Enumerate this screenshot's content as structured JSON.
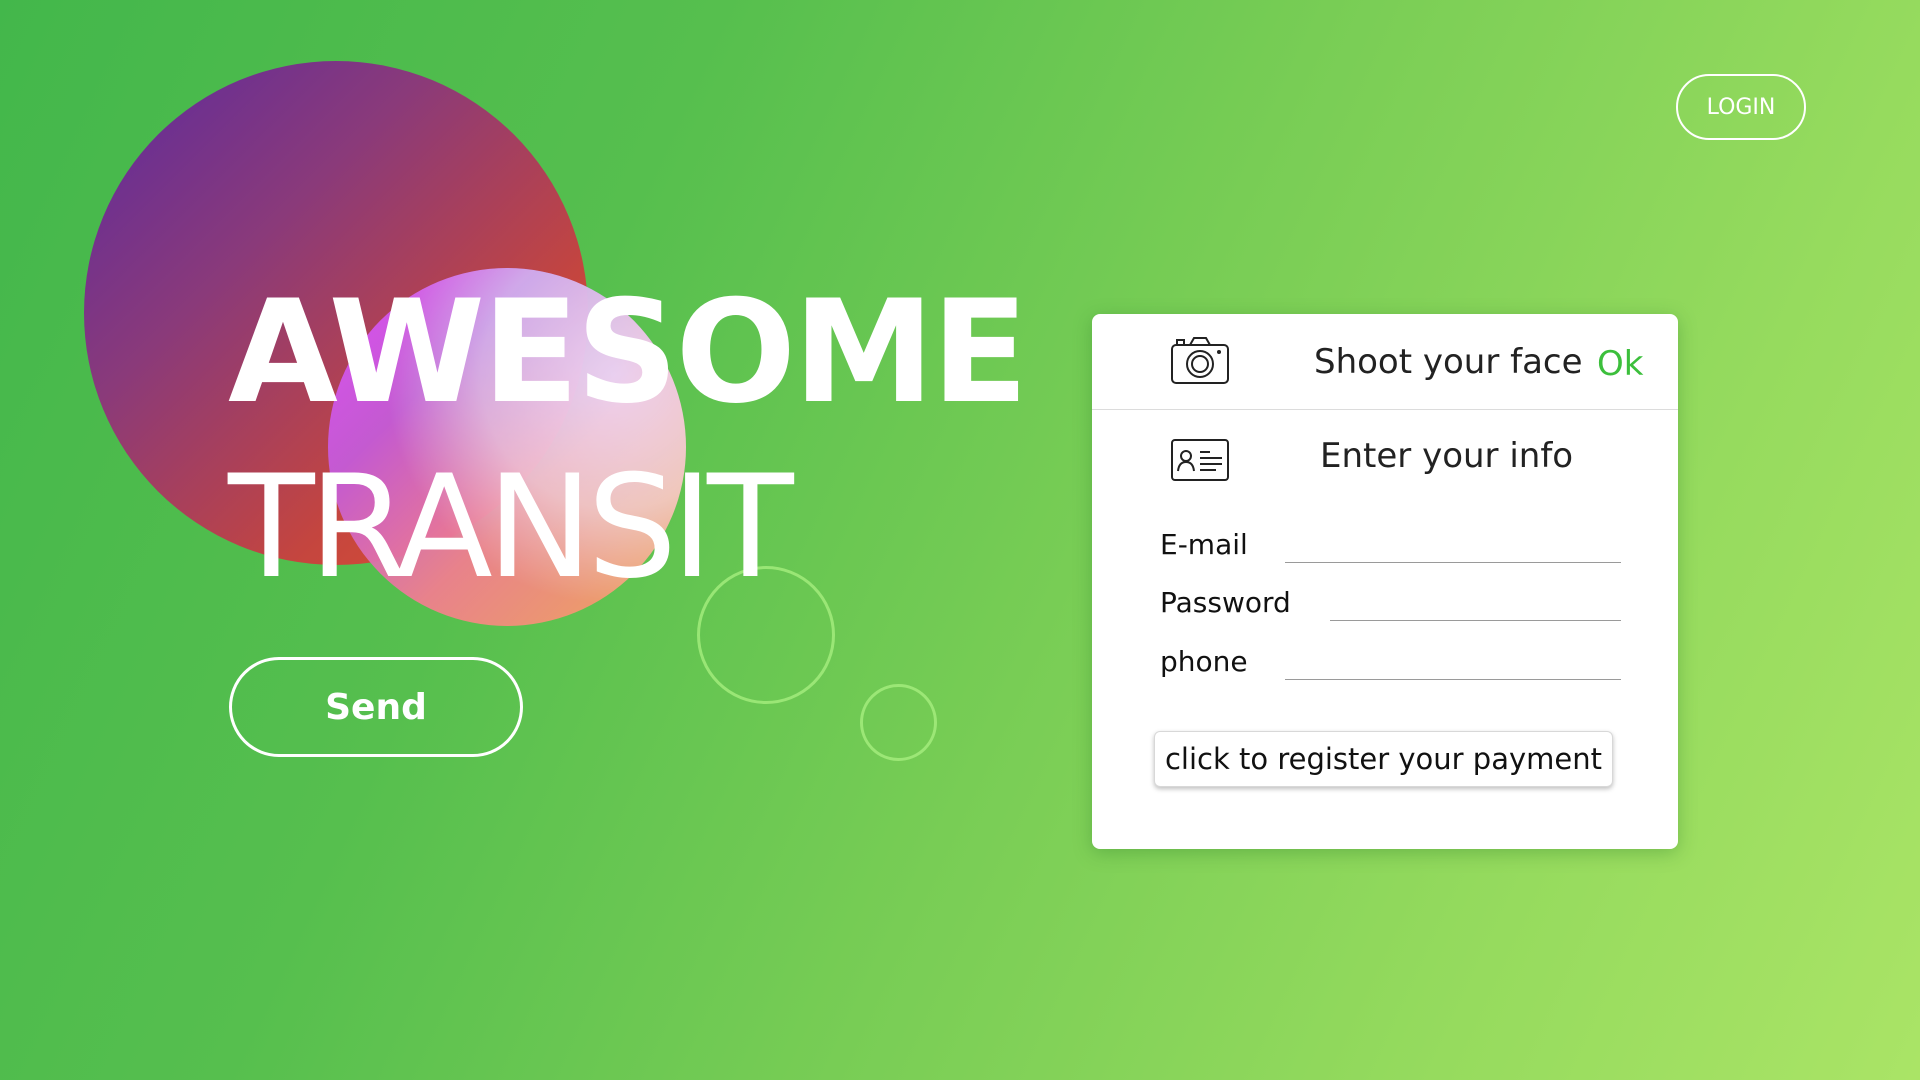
{
  "hero": {
    "title_line1": "AWESOME",
    "title_line2": "TRANSIT",
    "send_label": "Send"
  },
  "header": {
    "login_label": "LOGIN"
  },
  "card": {
    "face_label": "Shoot your face",
    "ok_label": "Ok",
    "info_label": "Enter your info",
    "fields": [
      {
        "label": "E-mail",
        "value": "",
        "placeholder": ""
      },
      {
        "label": "Password",
        "value": "",
        "placeholder": ""
      },
      {
        "label": "phone",
        "value": "",
        "placeholder": ""
      }
    ],
    "payment_button_label": "click to register your payment"
  },
  "icons": {
    "camera": "camera-icon",
    "id_card": "id-card-icon"
  },
  "colors": {
    "background_start": "#43b74b",
    "background_end": "#aae466",
    "ok_accent": "#3cbf3c",
    "circle_purple": "#5b2a9e",
    "circle_orange": "#e4542c",
    "circle_magenta": "#e150ff"
  }
}
